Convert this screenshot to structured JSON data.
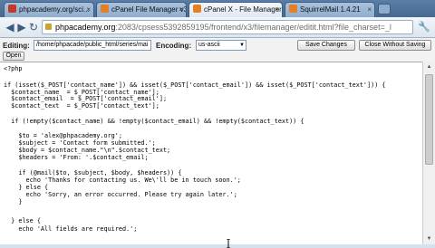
{
  "browser": {
    "tabs": [
      {
        "label": "phpacademy.org/sci...",
        "favicon_color": "#c0392b",
        "active": false
      },
      {
        "label": "cPanel File Manager v3",
        "favicon_color": "#e67e22",
        "active": false
      },
      {
        "label": "cPanel X - File Manager",
        "favicon_color": "#e67e22",
        "active": true
      },
      {
        "label": "SquirrelMail 1.4.21",
        "favicon_color": "#e67e22",
        "active": false
      }
    ],
    "tab_close_glyph": "×",
    "url_host": "phpacademy.org",
    "url_path": ":2083/cpsess5392859195/frontend/x3/filemanager/editit.html?file_charset=_l",
    "back_glyph": "◀",
    "forward_glyph": "▶",
    "reload_glyph": "↻",
    "wrench_glyph": "🔧"
  },
  "editor": {
    "editing_label": "Editing:",
    "path": "/home/phpacade/public_html/series/mai",
    "encoding_label": "Encoding:",
    "encoding_value": "us-ascii",
    "save_label": "Save Changes",
    "close_label": "Close Without Saving",
    "open_label": "Open",
    "code_lines": [
      "<?php",
      "",
      "if (isset($_POST['contact_name']) && isset($_POST['contact_email']) && isset($_POST['contact_text'])) {",
      "  $contact_name  = $_POST['contact_name'];",
      "  $contact_email  = $_POST['contact_email'];",
      "  $contact_text  = $_POST['contact_text'];",
      "",
      "  if (!empty($contact_name) && !empty($contact_email) && !empty($contact_text)) {",
      "",
      "    $to = 'alex@phpacademy.org';",
      "    $subject = 'Contact form submitted.';",
      "    $body = $contact_name.\"\\n\".$contact_text;",
      "    $headers = 'From: '.$contact_email;",
      "",
      "    if (@mail($to, $subject, $body, $headers)) {",
      "      echo 'Thanks for contacting us. We\\'ll be in touch soon.';",
      "    } else {",
      "      echo 'Sorry, an error occurred. Please try again later.';",
      "    }",
      "",
      "  } else {",
      "    echo 'All fields are required.';"
    ]
  }
}
